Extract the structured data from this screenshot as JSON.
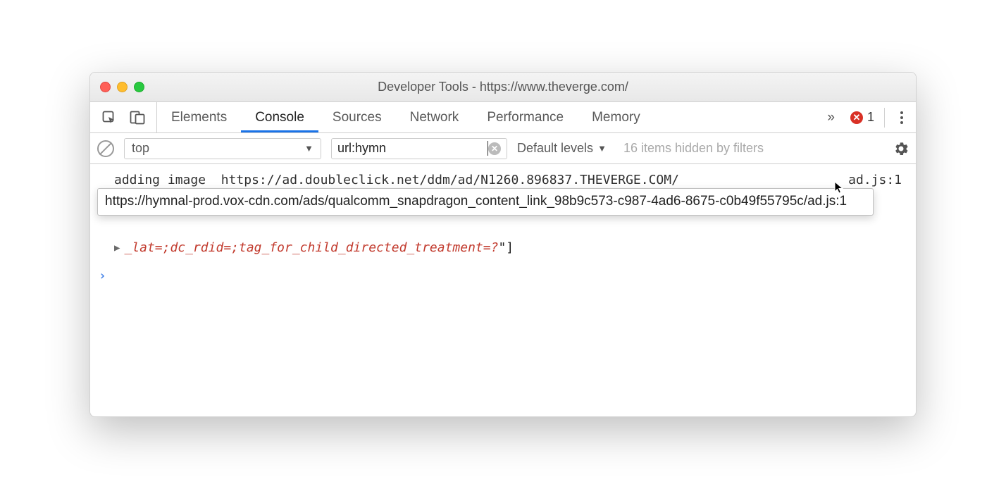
{
  "window": {
    "title": "Developer Tools - https://www.theverge.com/"
  },
  "tabs": {
    "items": [
      "Elements",
      "Console",
      "Sources",
      "Network",
      "Performance",
      "Memory"
    ],
    "active": "Console",
    "overflow": "»"
  },
  "errors": {
    "count": "1"
  },
  "filterbar": {
    "context": "top",
    "filter_value": "url:hymn",
    "levels": "Default levels",
    "hidden_text": "16 items hidden by filters"
  },
  "console": {
    "row1_left": "adding image  https://ad.doubleclick.net/ddm/ad/N1260.896837.THEVERGE.COM/",
    "row1_right": "ad.js:1",
    "tooltip": "https://hymnal-prod.vox-cdn.com/ads/qualcomm_snapdragon_content_link_98b9c573-c987-4ad6-8675-c0b49f55795c/ad.js:1",
    "row2_text": "_lat=;dc_rdid=;tag_for_child_directed_treatment=?",
    "row2_close": "\"]"
  }
}
